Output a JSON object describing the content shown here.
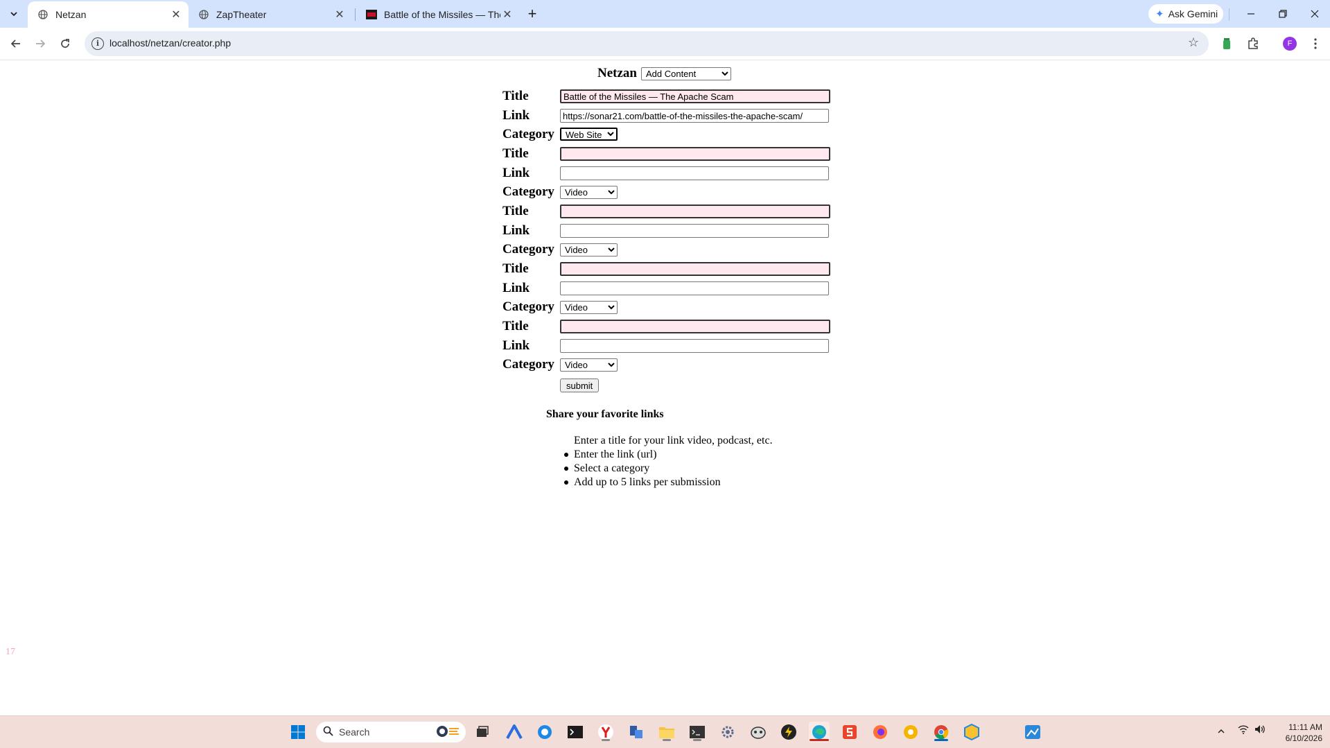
{
  "browser": {
    "tabs": [
      {
        "title": "Netzan",
        "active": true
      },
      {
        "title": "ZapTheater",
        "active": false
      },
      {
        "title": "Battle of the Missiles — The Ap",
        "active": false
      }
    ],
    "gemini_label": "Ask Gemini",
    "url": "localhost/netzan/creator.php",
    "profile_initial": "F"
  },
  "page": {
    "site_title": "Netzan",
    "nav_select": {
      "value": "Add Content"
    },
    "labels": {
      "title": "Title",
      "link": "Link",
      "category": "Category"
    },
    "entries": [
      {
        "title": "Battle of the Missiles — The Apache Scam",
        "link": "https://sonar21.com/battle-of-the-missiles-the-apache-scam/",
        "category": "Web Site"
      },
      {
        "title": "",
        "link": "",
        "category": "Video"
      },
      {
        "title": "",
        "link": "",
        "category": "Video"
      },
      {
        "title": "",
        "link": "",
        "category": "Video"
      },
      {
        "title": "",
        "link": "",
        "category": "Video"
      }
    ],
    "submit_label": "submit",
    "share_title": "Share your favorite links",
    "instructions": [
      "Enter a title for your link video, podcast, etc.",
      "Enter the link (url)",
      "Select a category",
      "Add up to 5 links per submission"
    ],
    "counter": "17"
  },
  "taskbar": {
    "search_placeholder": "Search",
    "clock_time": "11:11 AM",
    "clock_date": "6/10/2026"
  },
  "colors": {
    "tabstrip": "#d3e3fd",
    "title_field_bg": "#ffe8ee",
    "taskbar": "#f3ddd8",
    "counter": "#f4a6b8"
  }
}
